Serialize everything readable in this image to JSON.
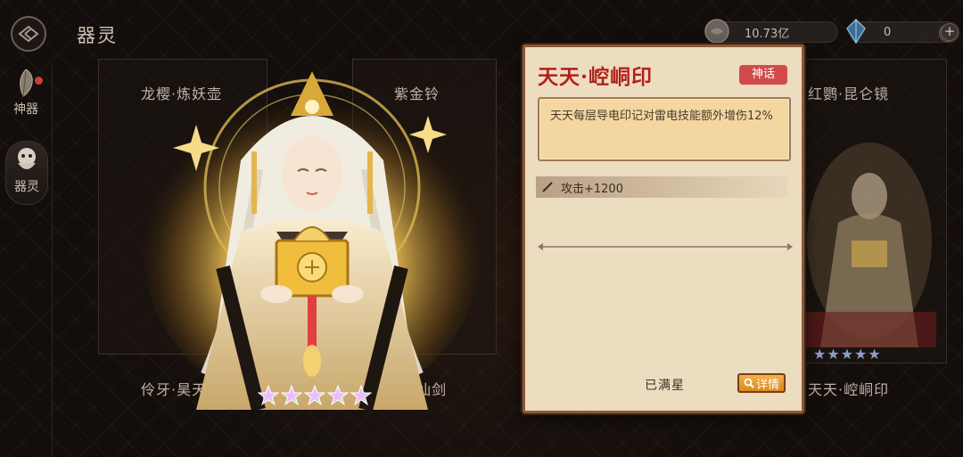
{
  "page_title": "器灵",
  "currency": [
    {
      "icon": "coin-icon",
      "value": "10.73亿"
    },
    {
      "icon": "crystal-icon",
      "value": "0"
    }
  ],
  "side_nav": [
    {
      "label": "神器",
      "icon": "feather-icon",
      "active": false,
      "has_dot": true
    },
    {
      "label": "器灵",
      "icon": "spirit-icon",
      "active": true,
      "has_dot": false
    }
  ],
  "cards": [
    {
      "name": "龙樱·炼妖壶"
    },
    {
      "name": "紫金铃"
    },
    {
      "name": "红鹦·昆仑镜"
    },
    {
      "name": "伶牙·昊天塔"
    },
    {
      "name": "流萤·诛仙剑"
    },
    {
      "name": "天天·崆峒印"
    }
  ],
  "hero_stars": 5,
  "popup": {
    "title": "天天·崆峒印",
    "rarity": "神话",
    "description": "天天每层导电印记对雷电技能额外增伤12%",
    "stat": "攻击+1200",
    "status": "已满星",
    "detail_label": "详情"
  },
  "colors": {
    "title_red": "#b0211b",
    "badge_red": "#d24a4a",
    "popup_bg": "#ecdcc0",
    "detail_orange": "#f4b04a"
  }
}
